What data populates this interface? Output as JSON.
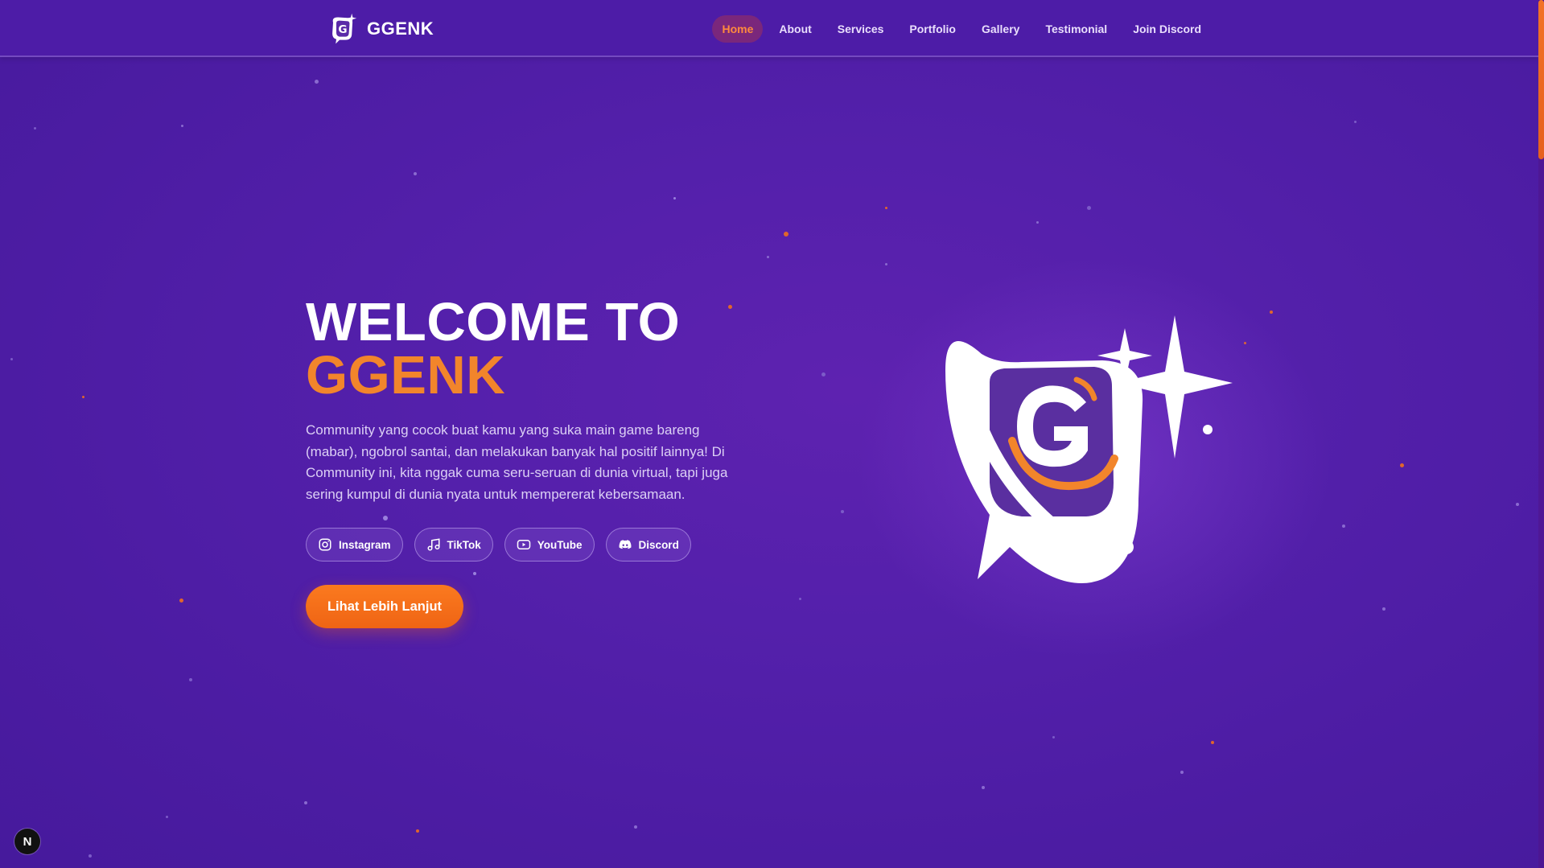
{
  "brand": {
    "name": "GGENK",
    "logo_icon": "ggenk-logo-icon"
  },
  "nav": {
    "items": [
      {
        "label": "Home",
        "active": true
      },
      {
        "label": "About",
        "active": false
      },
      {
        "label": "Services",
        "active": false
      },
      {
        "label": "Portfolio",
        "active": false
      },
      {
        "label": "Gallery",
        "active": false
      },
      {
        "label": "Testimonial",
        "active": false
      },
      {
        "label": "Join Discord",
        "active": false
      }
    ]
  },
  "hero": {
    "title_line1": "WELCOME TO",
    "title_line2": "GGENK",
    "description": "Community yang cocok buat kamu yang suka main game bareng (mabar), ngobrol santai, dan melakukan banyak hal positif lainnya! Di Community ini, kita nggak cuma seru-seruan di dunia virtual, tapi juga sering kumpul di dunia nyata untuk mempererat kebersamaan.",
    "socials": [
      {
        "label": "Instagram",
        "icon": "instagram-icon"
      },
      {
        "label": "TikTok",
        "icon": "music-note-icon"
      },
      {
        "label": "YouTube",
        "icon": "youtube-icon"
      },
      {
        "label": "Discord",
        "icon": "discord-icon"
      }
    ],
    "cta_label": "Lihat Lebih Lanjut"
  },
  "dev_badge": {
    "label": "N"
  },
  "colors": {
    "background": "#5420ab",
    "accent_orange": "#f2852b",
    "cta_orange": "#f56d18",
    "nav_active_text": "#ff8a3d"
  }
}
